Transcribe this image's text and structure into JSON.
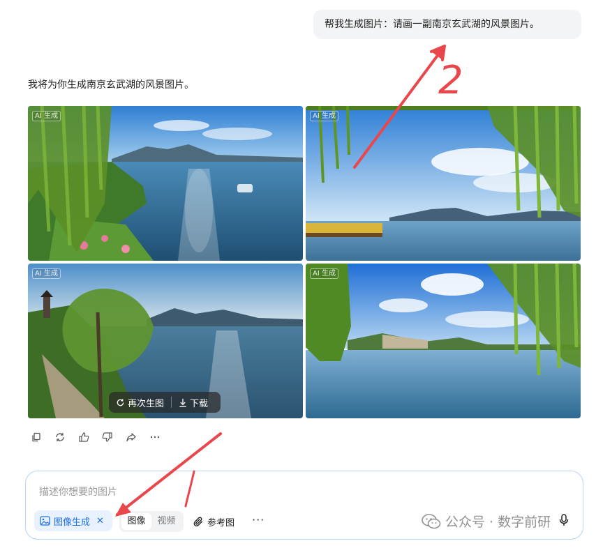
{
  "chat": {
    "user_message": "帮我生成图片：请画一副南京玄武湖的风景图片。",
    "reply": "我将为你生成南京玄武湖的风景图片。"
  },
  "images": {
    "badge": "AI 生成",
    "hover_actions": {
      "regenerate": "再次生图",
      "download": "下载"
    }
  },
  "message_actions": [
    {
      "icon": "copy-icon"
    },
    {
      "icon": "refresh-icon"
    },
    {
      "icon": "thumbs-up-icon"
    },
    {
      "icon": "thumbs-down-icon"
    },
    {
      "icon": "share-icon"
    },
    {
      "icon": "more-icon"
    }
  ],
  "composer": {
    "placeholder": "描述你想要的图片",
    "mode_chip": "图像生成",
    "segment": {
      "image": "图像",
      "video": "视频"
    },
    "reference": "参考图",
    "more": "···"
  },
  "annotation": {
    "number": "2",
    "color": "#e8474c"
  },
  "watermark": {
    "text": "公众号 · 数字前研"
  },
  "colors": {
    "accent": "#1f6fe5",
    "composer_border": "#b7d3f5"
  }
}
